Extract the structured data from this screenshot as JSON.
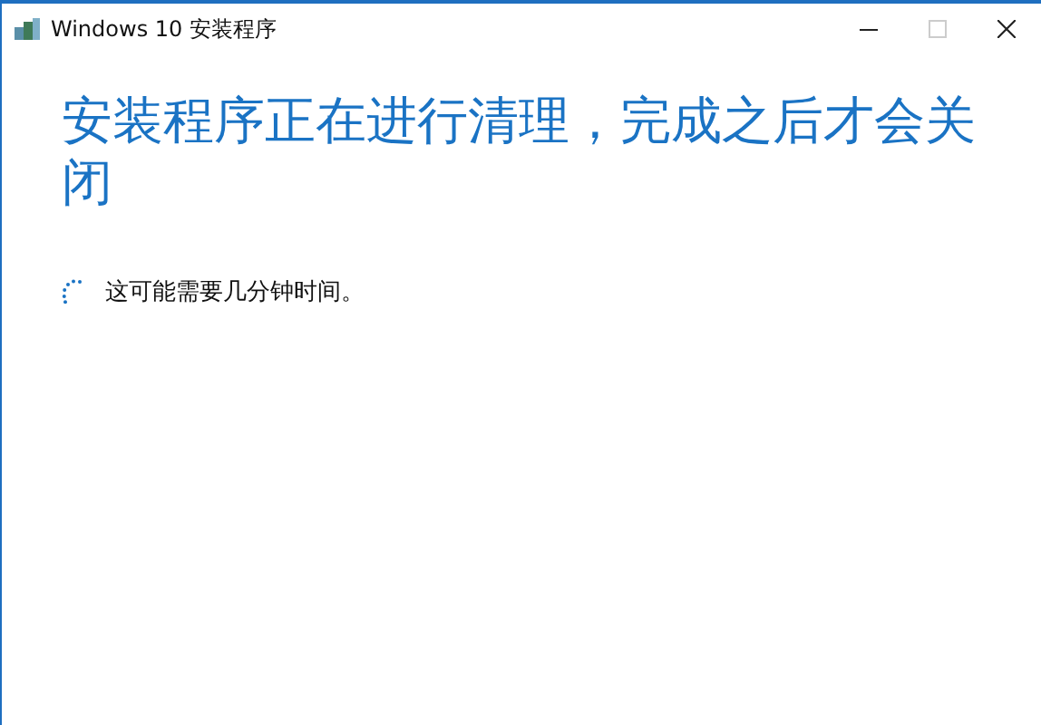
{
  "window": {
    "title": "Windows 10 安装程序",
    "controls": [
      {
        "kind": "minimize",
        "disabled": false
      },
      {
        "kind": "maximize",
        "disabled": true
      },
      {
        "kind": "close",
        "disabled": false
      }
    ]
  },
  "heading": "安装程序正在进行清理，完成之后才会关闭",
  "status": {
    "busy": true,
    "text": "这可能需要几分钟时间。"
  }
}
